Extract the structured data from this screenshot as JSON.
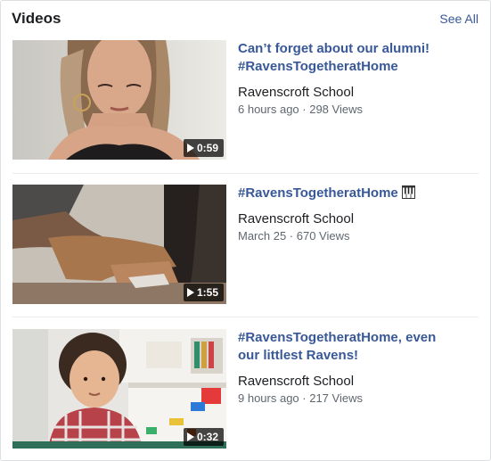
{
  "section": {
    "title": "Videos",
    "see_all": "See All"
  },
  "videos": [
    {
      "title_line1": "Can’t forget about our alumni!",
      "title_line2": "#RavensTogetheratHome",
      "channel": "Ravenscroft School",
      "meta": "6 hours ago · 298 Views",
      "duration": "0:59",
      "thumb_icon": "woman-portrait-thumbnail"
    },
    {
      "title_line1": "#RavensTogetheratHome",
      "title_emoji_icon": "piano-keys-icon",
      "channel": "Ravenscroft School",
      "meta": "March 25 · 670 Views",
      "duration": "1:55",
      "thumb_icon": "hand-on-piano-thumbnail"
    },
    {
      "title_line1": "#RavensTogetheratHome, even",
      "title_line2": "our littlest Ravens!",
      "channel": "Ravenscroft School",
      "meta": "9 hours ago · 217 Views",
      "duration": "0:32",
      "thumb_icon": "child-at-table-thumbnail"
    }
  ]
}
